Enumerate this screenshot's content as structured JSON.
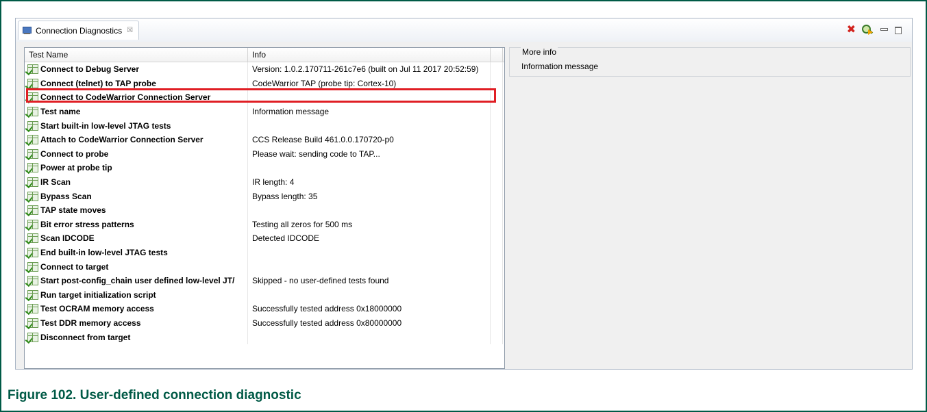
{
  "view": {
    "tab_label": "Connection Diagnostics",
    "tab_close": "☒",
    "toolbar": {
      "remove_icon": "✖",
      "remove_color": "#d2231e"
    }
  },
  "table": {
    "columns": [
      "Test Name",
      "Info"
    ],
    "rows": [
      {
        "name": "Connect to Debug Server",
        "info": "Version: 1.0.2.170711-261c7e6 (built on Jul 11 2017 20:52:59)"
      },
      {
        "name": "Connect (telnet) to TAP probe",
        "info": "CodeWarrior TAP (probe tip: Cortex-10)"
      },
      {
        "name": "Connect to CodeWarrior Connection Server",
        "info": ""
      },
      {
        "name": "Test name",
        "info": "Information message"
      },
      {
        "name": "Start built-in low-level JTAG tests",
        "info": ""
      },
      {
        "name": "Attach to CodeWarrior Connection Server",
        "info": "CCS Release Build 461.0.0.170720-p0"
      },
      {
        "name": "Connect to probe",
        "info": "Please wait: sending code to TAP..."
      },
      {
        "name": "Power at probe tip",
        "info": ""
      },
      {
        "name": "IR Scan",
        "info": "IR length: 4"
      },
      {
        "name": "Bypass Scan",
        "info": "Bypass length: 35"
      },
      {
        "name": "TAP state moves",
        "info": ""
      },
      {
        "name": "Bit error stress patterns",
        "info": "Testing all zeros for 500 ms"
      },
      {
        "name": "Scan IDCODE",
        "info": "Detected IDCODE"
      },
      {
        "name": "End built-in low-level JTAG tests",
        "info": ""
      },
      {
        "name": "Connect to target",
        "info": ""
      },
      {
        "name": "Start post-config_chain user defined low-level JT/",
        "info": "Skipped - no user-defined tests found"
      },
      {
        "name": "Run target initialization script",
        "info": ""
      },
      {
        "name": "Test OCRAM memory access",
        "info": "Successfully tested address 0x18000000"
      },
      {
        "name": "Test DDR memory access",
        "info": "Successfully tested address 0x80000000"
      },
      {
        "name": "Disconnect from target",
        "info": ""
      }
    ],
    "highlighted_row_color": "#e01e24"
  },
  "more_info": {
    "title": "More info",
    "text": "Information message"
  },
  "caption": "Figure 102.  User-defined connection diagnostic",
  "colors": {
    "brand": "#005a46"
  }
}
